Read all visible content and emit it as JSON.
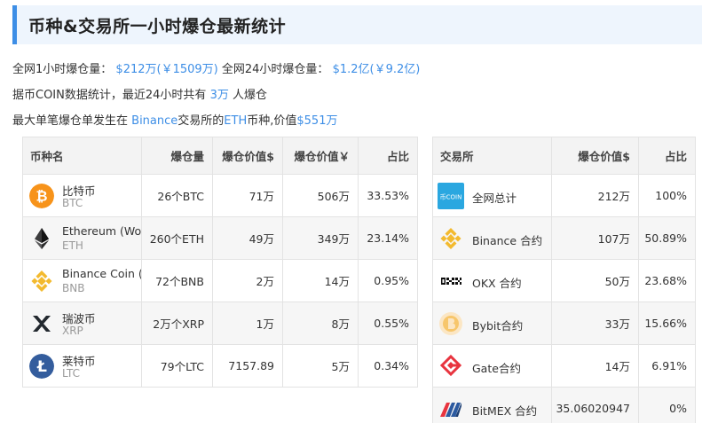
{
  "header": {
    "title": "币种&交易所一小时爆仓最新统计"
  },
  "stats": {
    "l1_prefix": "全网1小时爆仓量：",
    "l1_val": "$212万(￥1509万)",
    "l1_mid": "全网24小时爆仓量：",
    "l1_val2": "$1.2亿(￥9.2亿)",
    "l2_prefix": "据币COIN数据统计，最近24小时共有",
    "l2_val": "3万",
    "l2_suffix": "人爆仓",
    "l3_prefix": "最大单笔爆仓单发生在",
    "l3_exchange": "Binance",
    "l3_mid": "交易所的",
    "l3_coin": "ETH",
    "l3_mid2": "币种,价值",
    "l3_val": "$551万"
  },
  "coin_table": {
    "headers": [
      "币种名",
      "爆仓量",
      "爆仓价值$",
      "爆仓价值￥",
      "占比"
    ],
    "rows": [
      {
        "name": "比特币",
        "symbol": "BTC",
        "icon": "bitcoin-icon",
        "amount": "26个BTC",
        "usd": "71万",
        "cny": "506万",
        "pct": "33.53%"
      },
      {
        "name": "Ethereum (Wo",
        "symbol": "ETH",
        "icon": "ethereum-icon",
        "amount": "260个ETH",
        "usd": "49万",
        "cny": "349万",
        "pct": "23.14%"
      },
      {
        "name": "Binance Coin (",
        "symbol": "BNB",
        "icon": "binance-coin-icon",
        "amount": "72个BNB",
        "usd": "2万",
        "cny": "14万",
        "pct": "0.95%"
      },
      {
        "name": "瑞波币",
        "symbol": "XRP",
        "icon": "xrp-icon",
        "amount": "2万个XRP",
        "usd": "1万",
        "cny": "8万",
        "pct": "0.55%"
      },
      {
        "name": "莱特币",
        "symbol": "LTC",
        "icon": "litecoin-icon",
        "amount": "79个LTC",
        "usd": "7157.89",
        "cny": "5万",
        "pct": "0.34%"
      }
    ]
  },
  "exchange_table": {
    "headers": [
      "交易所",
      "爆仓价值$",
      "占比"
    ],
    "rows": [
      {
        "name": "全网总计",
        "icon": "bicoin-logo-icon",
        "usd": "212万",
        "pct": "100%",
        "logo_text": "币COIN"
      },
      {
        "name": "Binance 合约",
        "icon": "binance-logo-icon",
        "usd": "107万",
        "pct": "50.89%"
      },
      {
        "name": "OKX 合约",
        "icon": "okx-logo-icon",
        "usd": "50万",
        "pct": "23.68%"
      },
      {
        "name": "Bybit合约",
        "icon": "bybit-logo-icon",
        "usd": "33万",
        "pct": "15.66%"
      },
      {
        "name": "Gate合约",
        "icon": "gate-logo-icon",
        "usd": "14万",
        "pct": "6.91%"
      },
      {
        "name": "BitMEX 合约",
        "icon": "bitmex-logo-icon",
        "usd": "35.06020947",
        "pct": "0%"
      }
    ]
  },
  "colors": {
    "accent": "#3d8ee6",
    "header_bg": "#eef5fd",
    "bitcoin": "#f7931a",
    "binance": "#f3ba2f",
    "litecoin": "#345d9d",
    "gate": "#e8343f"
  }
}
